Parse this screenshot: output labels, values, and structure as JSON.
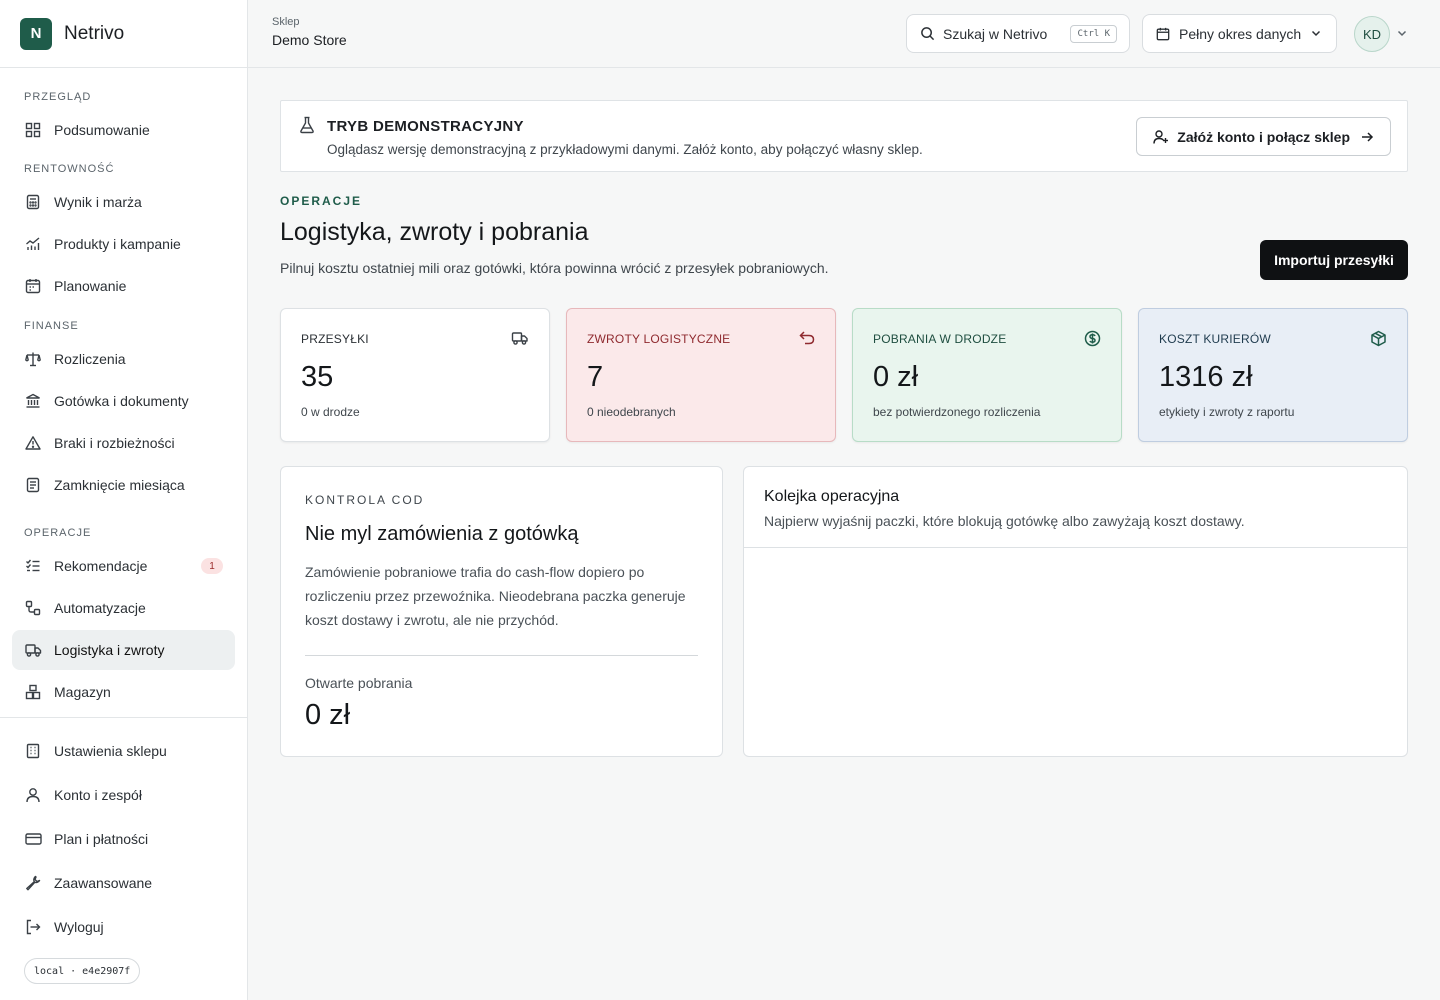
{
  "brand": {
    "logo_letter": "N",
    "name": "Netrivo"
  },
  "sidebar": {
    "sections": [
      {
        "title": "PRZEGLĄD",
        "items": [
          {
            "label": "Podsumowanie",
            "icon": "grid-icon"
          }
        ]
      },
      {
        "title": "RENTOWNOŚĆ",
        "items": [
          {
            "label": "Wynik i marża",
            "icon": "calculator-icon"
          },
          {
            "label": "Produkty i kampanie",
            "icon": "chart-icon"
          },
          {
            "label": "Planowanie",
            "icon": "calendar-icon"
          }
        ]
      },
      {
        "title": "FINANSE",
        "items": [
          {
            "label": "Rozliczenia",
            "icon": "scale-icon"
          },
          {
            "label": "Gotówka i dokumenty",
            "icon": "bank-icon"
          },
          {
            "label": "Braki i rozbieżności",
            "icon": "warning-icon"
          },
          {
            "label": "Zamknięcie miesiąca",
            "icon": "document-icon"
          }
        ]
      },
      {
        "title": "OPERACJE",
        "items": [
          {
            "label": "Rekomendacje",
            "icon": "checklist-icon",
            "badge": "1"
          },
          {
            "label": "Automatyzacje",
            "icon": "workflow-icon"
          },
          {
            "label": "Logistyka i zwroty",
            "icon": "truck-icon",
            "active": true
          },
          {
            "label": "Magazyn",
            "icon": "boxes-icon"
          }
        ]
      }
    ],
    "bottom": [
      {
        "label": "Ustawienia sklepu",
        "icon": "building-icon"
      },
      {
        "label": "Konto i zespół",
        "icon": "user-icon"
      },
      {
        "label": "Plan i płatności",
        "icon": "credit-card-icon"
      },
      {
        "label": "Zaawansowane",
        "icon": "wrench-icon"
      },
      {
        "label": "Wyloguj",
        "icon": "logout-icon"
      }
    ],
    "version": "local · e4e2907f"
  },
  "header": {
    "store_label": "Sklep",
    "store_name": "Demo Store",
    "search_placeholder": "Szukaj w Netrivo",
    "search_shortcut": "Ctrl K",
    "period": "Pełny okres danych",
    "avatar": "KD"
  },
  "demo": {
    "title": "TRYB DEMONSTRACYJNY",
    "text": "Oglądasz wersję demonstracyjną z przykładowymi danymi. Załóż konto, aby połączyć własny sklep.",
    "button": "Załóż konto i połącz sklep"
  },
  "page": {
    "kicker": "OPERACJE",
    "title": "Logistyka, zwroty i pobrania",
    "subtitle": "Pilnuj kosztu ostatniej mili oraz gotówki, która powinna wrócić z przesyłek pobraniowych.",
    "import_button": "Importuj przesyłki"
  },
  "kpis": [
    {
      "label": "PRZESYŁKI",
      "value": "35",
      "sub": "0 w drodze",
      "variant": "neutral"
    },
    {
      "label": "ZWROTY LOGISTYCZNE",
      "value": "7",
      "sub": "0 nieodebranych",
      "variant": "red"
    },
    {
      "label": "POBRANIA W DRODZE",
      "value": "0 zł",
      "sub": "bez potwierdzonego rozliczenia",
      "variant": "green"
    },
    {
      "label": "KOSZT KURIERÓW",
      "value": "1316 zł",
      "sub": "etykiety i zwroty z raportu",
      "variant": "blue"
    }
  ],
  "cod": {
    "kicker": "KONTROLA COD",
    "title": "Nie myl zamówienia z gotówką",
    "text": "Zamówienie pobraniowe trafia do cash-flow dopiero po rozliczeniu przez przewoźnika. Nieodebrana paczka generuje koszt dostawy i zwrotu, ale nie przychód.",
    "open_label": "Otwarte pobrania",
    "open_value": "0 zł"
  },
  "queue": {
    "title": "Kolejka operacyjna",
    "subtitle": "Najpierw wyjaśnij paczki, które blokują gotówkę albo zawyżają koszt dostawy."
  },
  "colors": {
    "accent": "#1f5c4a",
    "dark_button": "#0f1113",
    "badge_bg": "#fbe2e2"
  }
}
